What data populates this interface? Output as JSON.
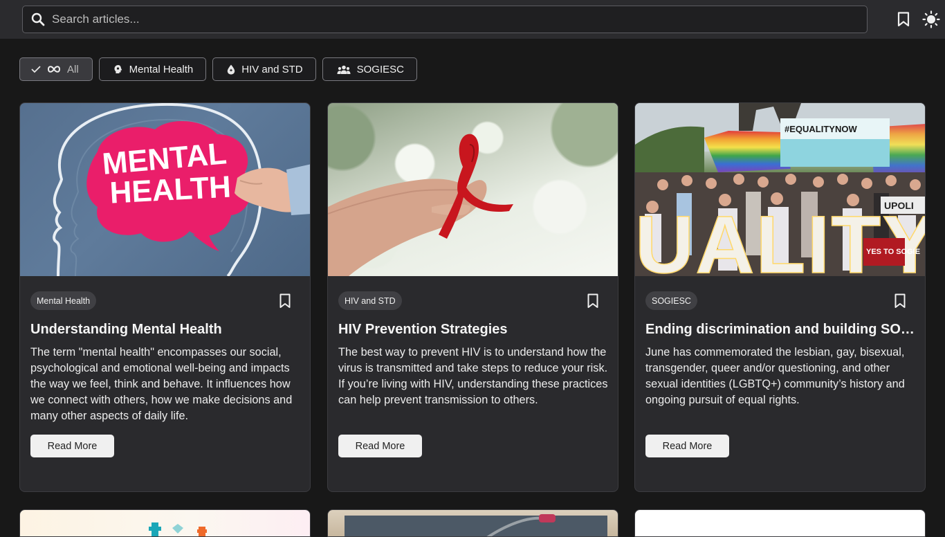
{
  "search": {
    "placeholder": "Search articles..."
  },
  "filters": [
    {
      "label": "All",
      "icon": "infinity-icon",
      "active": true
    },
    {
      "label": "Mental Health",
      "icon": "brain-icon",
      "active": false
    },
    {
      "label": "HIV and STD",
      "icon": "drop-icon",
      "active": false
    },
    {
      "label": "SOGIESC",
      "icon": "people-icon",
      "active": false
    }
  ],
  "articles": [
    {
      "category": "Mental Health",
      "title": "Understanding Mental Health",
      "description": "The term \"mental health\" encompasses our social, psychological and emotional well-being and impacts the way we feel, think and behave. It influences how we connect with others, how we make decisions and many other aspects of daily life.",
      "read_more": "Read More",
      "image_text": [
        "MENTAL",
        "HEALTH"
      ]
    },
    {
      "category": "HIV and STD",
      "title": "HIV Prevention Strategies",
      "description": "The best way to prevent HIV is to understand how the virus is transmitted and take steps to reduce your risk. If you’re living with HIV, understanding these practices can help prevent transmission to others.",
      "read_more": "Read More"
    },
    {
      "category": "SOGIESC",
      "title": "Ending discrimination and building SOGIESC-inclusive communities",
      "description": "June has commemorated the lesbian, gay, bisexual, transgender, queer and/or questioning, and other sexual identities (LGBTQ+) community’s history and ongoing pursuit of equal rights.",
      "read_more": "Read More",
      "image_text": [
        "#EQUALITYNOW",
        "UALITY",
        "YES TO SOGIE",
        "UPOLI"
      ]
    }
  ],
  "colors": {
    "accent_pink": "#ea1e6a",
    "ribbon_red": "#c8161e",
    "bg": "#181818",
    "card": "#2a2a2d"
  }
}
